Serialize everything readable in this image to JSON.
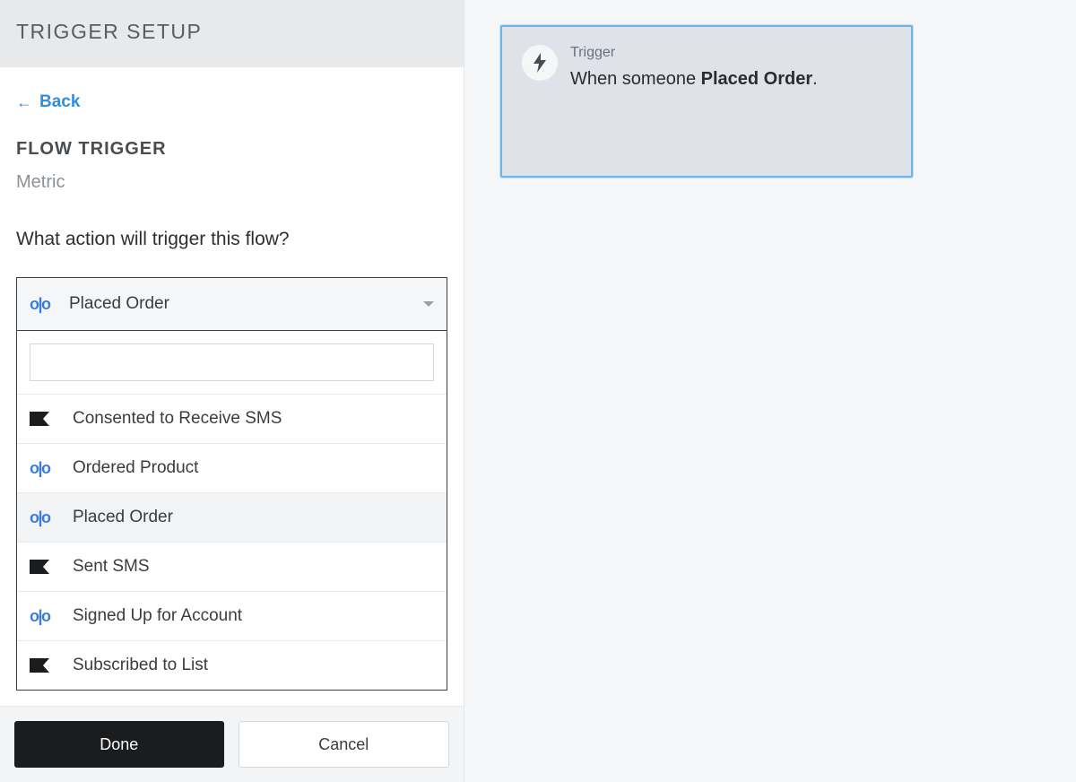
{
  "sidebar": {
    "header_title": "TRIGGER SETUP",
    "back_label": "Back",
    "section_heading": "FLOW TRIGGER",
    "subheading": "Metric",
    "question": "What action will trigger this flow?"
  },
  "dropdown": {
    "selected_label": "Placed Order",
    "selected_icon": "olo",
    "search_value": "",
    "options": [
      {
        "icon": "flag",
        "label": "Consented to Receive SMS",
        "highlighted": false
      },
      {
        "icon": "olo",
        "label": "Ordered Product",
        "highlighted": false
      },
      {
        "icon": "olo",
        "label": "Placed Order",
        "highlighted": true
      },
      {
        "icon": "flag",
        "label": "Sent SMS",
        "highlighted": false
      },
      {
        "icon": "olo",
        "label": "Signed Up for Account",
        "highlighted": false
      },
      {
        "icon": "flag",
        "label": "Subscribed to List",
        "highlighted": false
      }
    ]
  },
  "footer": {
    "done_label": "Done",
    "cancel_label": "Cancel"
  },
  "trigger_card": {
    "label": "Trigger",
    "prefix": "When someone ",
    "metric": "Placed Order",
    "suffix": "."
  }
}
